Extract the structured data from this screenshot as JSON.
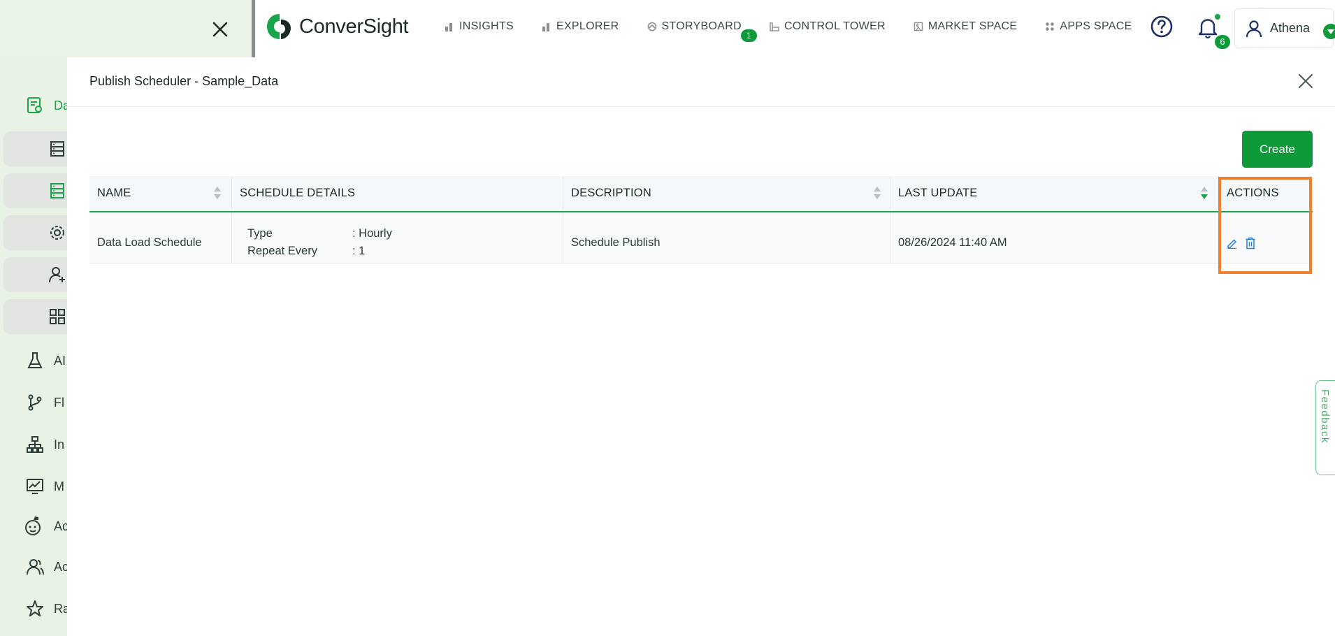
{
  "header": {
    "brand": "ConverSight",
    "nav": [
      {
        "label": "INSIGHTS",
        "icon": "bar-chart-icon"
      },
      {
        "label": "EXPLORER",
        "icon": "bar-chart-icon"
      },
      {
        "label": "STORYBOARD",
        "icon": "storyboard-icon",
        "badge": "1"
      },
      {
        "label": "CONTROL TOWER",
        "icon": "tower-icon"
      },
      {
        "label": "MARKET SPACE",
        "icon": "store-icon"
      },
      {
        "label": "APPS SPACE",
        "icon": "apps-grid-icon"
      }
    ],
    "notification_count": "6",
    "user_name": "Athena"
  },
  "sidebar": {
    "items": [
      {
        "label": "Da",
        "icon": "data-icon"
      },
      {
        "label": "AI",
        "icon": "flask-icon"
      },
      {
        "label": "Fl",
        "icon": "flow-icon"
      },
      {
        "label": "In",
        "icon": "hierarchy-icon"
      },
      {
        "label": "M",
        "icon": "monitor-chart-icon"
      },
      {
        "label": "Ac",
        "icon": "agent-icon"
      },
      {
        "label": "Ac",
        "icon": "users-icon"
      },
      {
        "label": "Ra",
        "icon": "star-icon"
      }
    ]
  },
  "panel": {
    "title": "Publish Scheduler - Sample_Data",
    "create_label": "Create",
    "columns": [
      "NAME",
      "SCHEDULE DETAILS",
      "DESCRIPTION",
      "LAST UPDATE",
      "ACTIONS"
    ],
    "rows": [
      {
        "name": "Data Load Schedule",
        "type_key": "Type",
        "type_value": ": Hourly",
        "repeat_key": "Repeat Every",
        "repeat_value": ": 1",
        "description": "Schedule Publish",
        "last_update": "08/26/2024 11:40 AM"
      }
    ]
  },
  "feedback_label": "Feedback",
  "colors": {
    "accent": "#0f9a3a",
    "highlight": "#f07f2e",
    "sidebar_bg": "#e8f2e5"
  }
}
